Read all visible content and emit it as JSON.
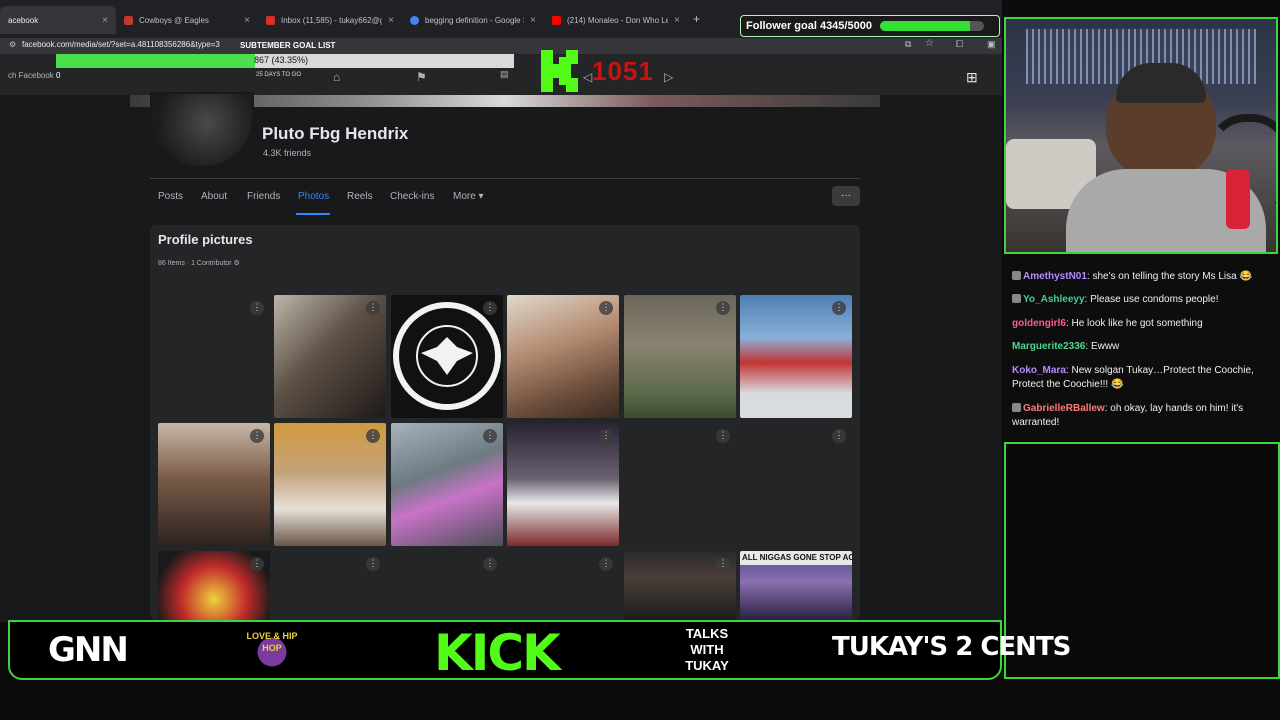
{
  "browser": {
    "tabs": [
      {
        "label": "acebook",
        "close": "×",
        "active": true,
        "color": "#1877f2"
      },
      {
        "label": "Cowboys @ Eagles",
        "close": "×",
        "color": "#c0392b"
      },
      {
        "label": "Inbox (11,585) - tukay662@g",
        "close": "×",
        "color": "#d93025"
      },
      {
        "label": "begging definition - Google S",
        "close": "×",
        "color": "#4285f4"
      },
      {
        "label": "(214) Monaleo - Don Who Le",
        "close": "×",
        "color": "#ff0000"
      }
    ],
    "new_tab": "+",
    "url": "facebook.com/media/set/?set=a.481108356286&type=3"
  },
  "facebook_nav": {
    "search_label": "ch Facebook"
  },
  "sub_goal": {
    "title": "SUBTEMBER GOAL LIST",
    "progress_text": "867 (43.35%)",
    "progress": 0.4335,
    "days": "25 DAYS TO GO",
    "start": "0"
  },
  "kick_counter": "1051",
  "follower_goal": {
    "text": "Follower goal 4345/5000",
    "progress": 0.869
  },
  "profile": {
    "name": "Pluto Fbg Hendrix",
    "friends": "4.3K friends",
    "tabs": [
      "Posts",
      "About",
      "Friends",
      "Photos",
      "Reels",
      "Check-ins",
      "More ▾"
    ],
    "active_tab": "Photos",
    "more_button": "···"
  },
  "album": {
    "title": "Profile pictures",
    "meta": "86 Items · 1 Contributor ⚙",
    "dots": "⋮",
    "caption": "ALL NIGGAS GONE STOP ACTIN"
  },
  "chat": [
    {
      "user": "AmethystN01",
      "text": "she's on telling the story Ms Lisa 😂",
      "color": "#b58cff",
      "badge": true
    },
    {
      "user": "Yo_Ashleeyy",
      "text": "Please use condoms people!",
      "color": "#3fd18f",
      "badge": true
    },
    {
      "user": "goldengirl6",
      "text": "He look like he got something",
      "color": "#ff5c8a",
      "badge": false
    },
    {
      "user": "Marguerite2336",
      "text": "Ewww",
      "color": "#4fd68a",
      "badge": false
    },
    {
      "user": "Koko_Mara",
      "text": "New solgan Tukay…Protect the Coochie, Protect the Coochie!!! 😂",
      "color": "#b58cff",
      "badge": false
    },
    {
      "user": "GabrielleRBallew",
      "text": "oh okay, lay hands on him! it's warranted!",
      "color": "#ff7a7a",
      "badge": true
    }
  ],
  "banner": {
    "logos": [
      "GNN",
      "LOVE & HIP HOP",
      "KICK",
      "TALKS WITH TUKAY",
      "TUKAY'S 2 CENTS"
    ]
  },
  "colors": {
    "kick_green": "#53fc18",
    "fb_blue": "#2d88ff",
    "stream_green": "#3ed43e"
  }
}
